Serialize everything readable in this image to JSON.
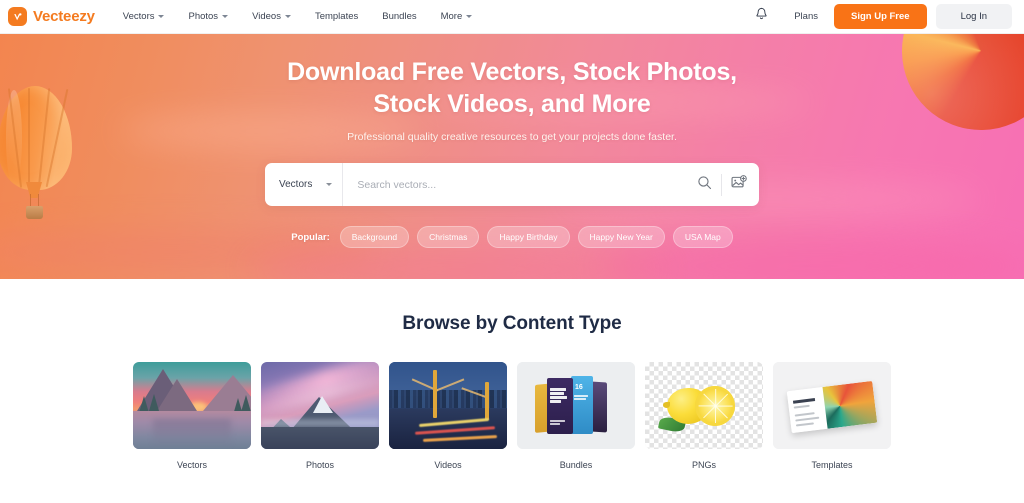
{
  "header": {
    "logo_text": "Vecteezy",
    "logo_icon": "vecteezy-v-logo-icon",
    "nav": [
      {
        "label": "Vectors",
        "has_caret": true
      },
      {
        "label": "Photos",
        "has_caret": true
      },
      {
        "label": "Videos",
        "has_caret": true
      },
      {
        "label": "Templates",
        "has_caret": false
      },
      {
        "label": "Bundles",
        "has_caret": false
      },
      {
        "label": "More",
        "has_caret": true
      }
    ],
    "notifications_icon": "bell-icon",
    "plans_label": "Plans",
    "signup_label": "Sign Up Free",
    "login_label": "Log In"
  },
  "hero": {
    "title_line1": "Download Free Vectors, Stock Photos,",
    "title_line2": "Stock Videos, and More",
    "subtitle": "Professional quality creative resources to get your projects done faster.",
    "search": {
      "category_value": "Vectors",
      "placeholder": "Search vectors...",
      "search_icon": "search-icon",
      "image_search_icon": "image-search-icon"
    },
    "popular": {
      "label": "Popular:",
      "tags": [
        "Background",
        "Christmas",
        "Happy Birthday",
        "Happy New Year",
        "USA Map"
      ]
    }
  },
  "browse": {
    "title": "Browse by Content Type",
    "cards": [
      {
        "label": "Vectors"
      },
      {
        "label": "Photos"
      },
      {
        "label": "Videos"
      },
      {
        "label": "Bundles"
      },
      {
        "label": "PNGs"
      },
      {
        "label": "Templates"
      }
    ]
  },
  "colors": {
    "brand_orange": "#f47b20",
    "signup_orange": "#f97316",
    "login_gray": "#f1f2f4",
    "heading_navy": "#1f2b45",
    "hero_gradient_start": "#f3854f",
    "hero_gradient_end": "#f76fb4"
  }
}
